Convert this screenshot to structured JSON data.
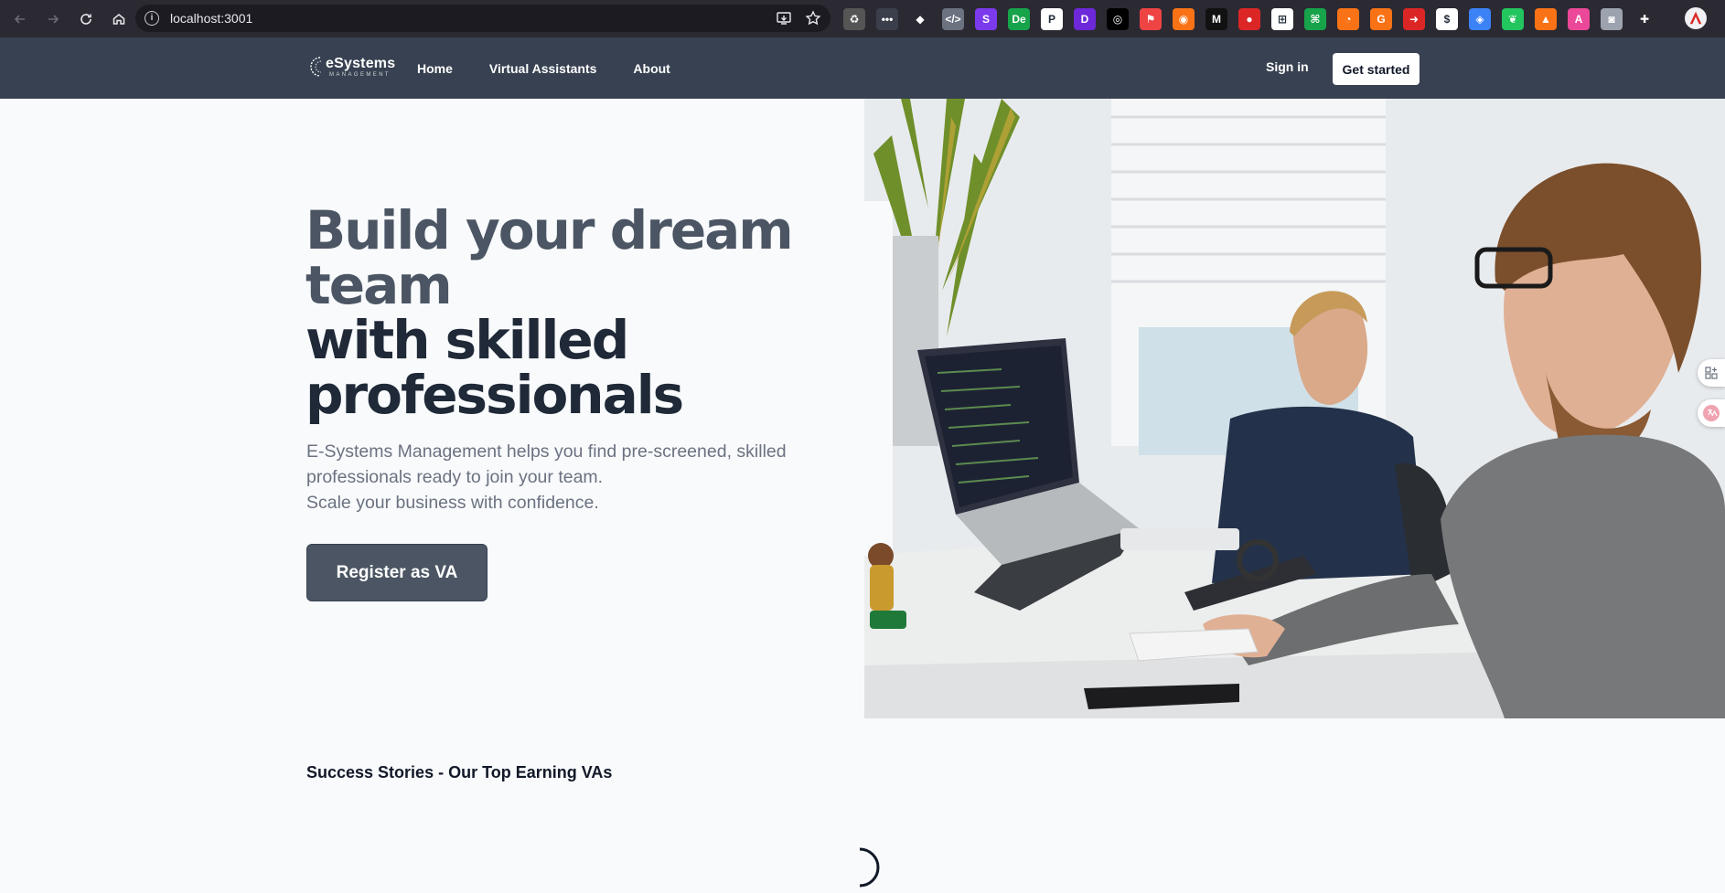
{
  "browser": {
    "url": "localhost:3001",
    "extensions": [
      {
        "name": "recycle-ext-icon",
        "color": "#555555",
        "glyph": "♻"
      },
      {
        "name": "dots-ext-icon",
        "color": "#3a3f4b",
        "glyph": "•••"
      },
      {
        "name": "tag-ext-icon",
        "color": "#2b2a33",
        "glyph": "◆"
      },
      {
        "name": "code-ext-icon",
        "color": "#6b7280",
        "glyph": "</>"
      },
      {
        "name": "s-ext-icon",
        "color": "#7c3aed",
        "glyph": "S"
      },
      {
        "name": "de-ext-icon",
        "color": "#16a34a",
        "glyph": "De"
      },
      {
        "name": "p-ext-icon",
        "color": "#ffffff",
        "glyph": "P"
      },
      {
        "name": "d-ext-icon",
        "color": "#6d28d9",
        "glyph": "D"
      },
      {
        "name": "openai-ext-icon",
        "color": "#000000",
        "glyph": "◎"
      },
      {
        "name": "flag-ext-icon",
        "color": "#ef4444",
        "glyph": "⚑"
      },
      {
        "name": "camera-ext-icon",
        "color": "#f97316",
        "glyph": "◉"
      },
      {
        "name": "m-ext-icon",
        "color": "#111111",
        "glyph": "M"
      },
      {
        "name": "red-ext-icon",
        "color": "#dc2626",
        "glyph": "●"
      },
      {
        "name": "cart-ext-icon",
        "color": "#ffffff",
        "glyph": "⊞"
      },
      {
        "name": "green-ext-icon",
        "color": "#16a34a",
        "glyph": "⌘"
      },
      {
        "name": "orange-ext-icon",
        "color": "#f97316",
        "glyph": "◔"
      },
      {
        "name": "g-ext-icon",
        "color": "#f97316",
        "glyph": "G"
      },
      {
        "name": "arrow-ext-icon",
        "color": "#dc2626",
        "glyph": "➜"
      },
      {
        "name": "dollar-ext-icon",
        "color": "#ffffff",
        "glyph": "$"
      },
      {
        "name": "map-ext-icon",
        "color": "#3b82f6",
        "glyph": "◈"
      },
      {
        "name": "leaf-ext-icon",
        "color": "#22c55e",
        "glyph": "❦"
      },
      {
        "name": "fox-ext-icon",
        "color": "#f97316",
        "glyph": "▲"
      },
      {
        "name": "translate-ext-icon",
        "color": "#ec4899",
        "glyph": "A"
      },
      {
        "name": "screenshot-ext-icon",
        "color": "#9ca3af",
        "glyph": "◙"
      },
      {
        "name": "puzzle-ext-icon",
        "color": "#2b2a33",
        "glyph": "✚"
      }
    ]
  },
  "header": {
    "logo_main": "eSystems",
    "logo_sub": "MANAGEMENT",
    "nav": [
      "Home",
      "Virtual Assistants",
      "About"
    ],
    "signin": "Sign in",
    "cta": "Get started"
  },
  "hero": {
    "title_line1": "Build your dream team",
    "title_line2": "with skilled professionals",
    "desc_line1": "E-Systems Management helps you find pre-screened, skilled professionals ready to join your team.",
    "desc_line2": "Scale your business with confidence.",
    "button": "Register as VA"
  },
  "stories": {
    "title": "Success Stories - Our Top Earning VAs"
  }
}
